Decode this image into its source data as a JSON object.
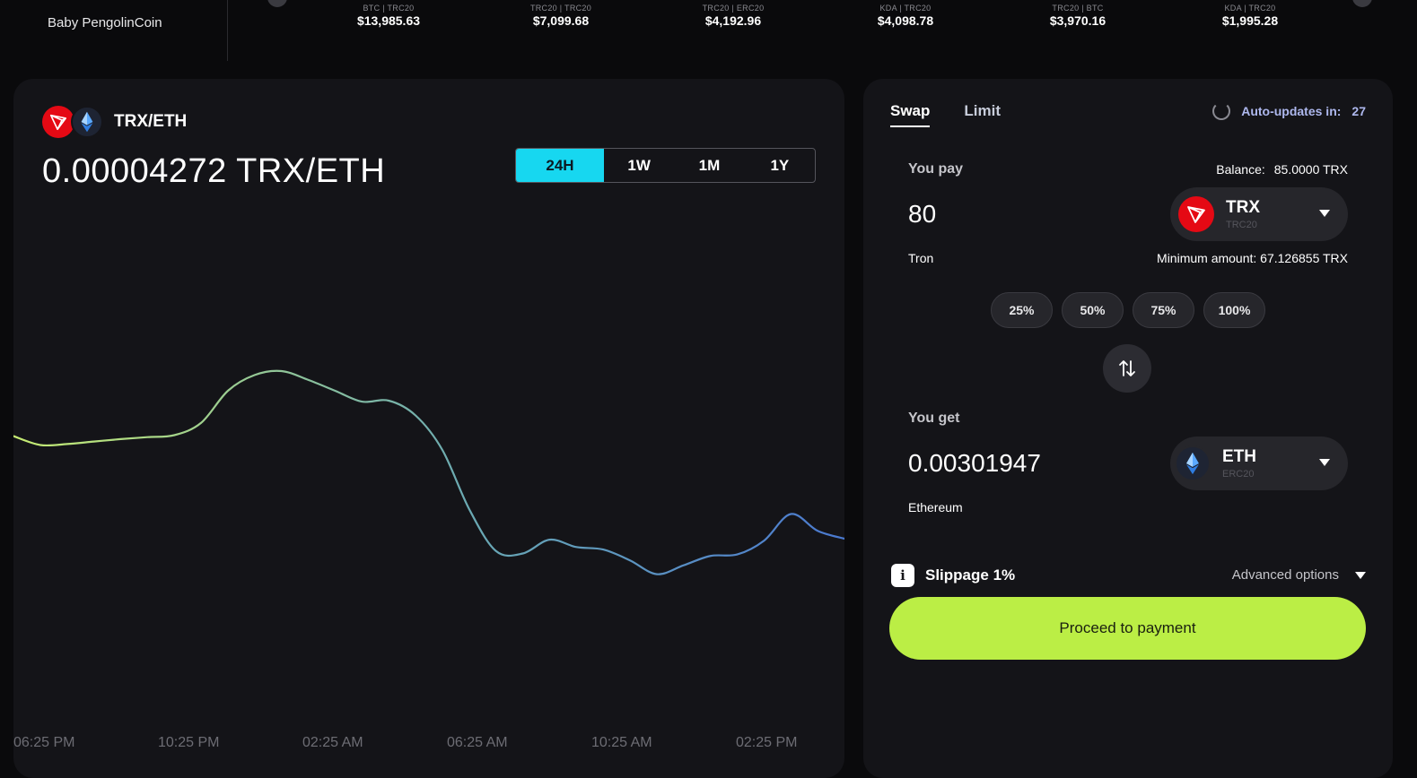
{
  "header": {
    "brand": "Baby PengolinCoin",
    "tickers": [
      {
        "pair": "BTC | TRC20",
        "price": "$13,985.63"
      },
      {
        "pair": "TRC20 | TRC20",
        "price": "$7,099.68"
      },
      {
        "pair": "TRC20 | ERC20",
        "price": "$4,192.96"
      },
      {
        "pair": "KDA | TRC20",
        "price": "$4,098.78"
      },
      {
        "pair": "TRC20 | BTC",
        "price": "$3,970.16"
      },
      {
        "pair": "KDA | TRC20",
        "price": "$1,995.28"
      }
    ]
  },
  "chart_panel": {
    "pair": "TRX/ETH",
    "rate": "0.00004272 TRX/ETH",
    "ranges": [
      "24H",
      "1W",
      "1M",
      "1Y"
    ],
    "active_range": "24H"
  },
  "chart_data": {
    "type": "line",
    "x": [
      "06:25 PM",
      "10:25 PM",
      "02:25 AM",
      "06:25 AM",
      "10:25 AM",
      "02:25 PM"
    ],
    "x_ticks": [
      "06:25 PM",
      "10:25 PM",
      "02:25 AM",
      "06:25 AM",
      "10:25 AM",
      "02:25 PM"
    ],
    "series": [
      {
        "values": [
          0.548,
          0.53,
          0.532,
          0.537,
          0.542,
          0.546,
          0.55,
          0.575,
          0.64,
          0.672,
          0.68,
          0.662,
          0.64,
          0.618,
          0.62,
          0.59,
          0.52,
          0.4,
          0.315,
          0.31,
          0.338,
          0.323,
          0.318,
          0.296,
          0.268,
          0.286,
          0.305,
          0.308,
          0.336,
          0.39,
          0.356,
          0.34
        ]
      }
    ],
    "gradient": [
      "#c6ec73",
      "#6aa9b3",
      "#4a79d0"
    ],
    "grid": false,
    "legend": "none"
  },
  "swap": {
    "tabs": [
      "Swap",
      "Limit"
    ],
    "auto_update_label": "Auto-updates in:",
    "auto_update_value": "27",
    "pay": {
      "label": "You pay",
      "balance_label": "Balance:",
      "balance_value": "85.0000 TRX",
      "amount": "80",
      "token_name": "Tron",
      "token_symbol": "TRX",
      "token_network": "TRC20",
      "minimum": "Minimum amount: 67.126855 TRX"
    },
    "percents": [
      "25%",
      "50%",
      "75%",
      "100%"
    ],
    "get": {
      "label": "You get",
      "amount": "0.00301947",
      "token_name": "Ethereum",
      "token_symbol": "ETH",
      "token_network": "ERC20"
    },
    "slippage": "Slippage 1%",
    "advanced": "Advanced options",
    "proceed": "Proceed to payment"
  },
  "colors": {
    "accent_cyan": "#17d7f0",
    "accent_green": "#bbee45",
    "trx_red": "#e50914"
  }
}
